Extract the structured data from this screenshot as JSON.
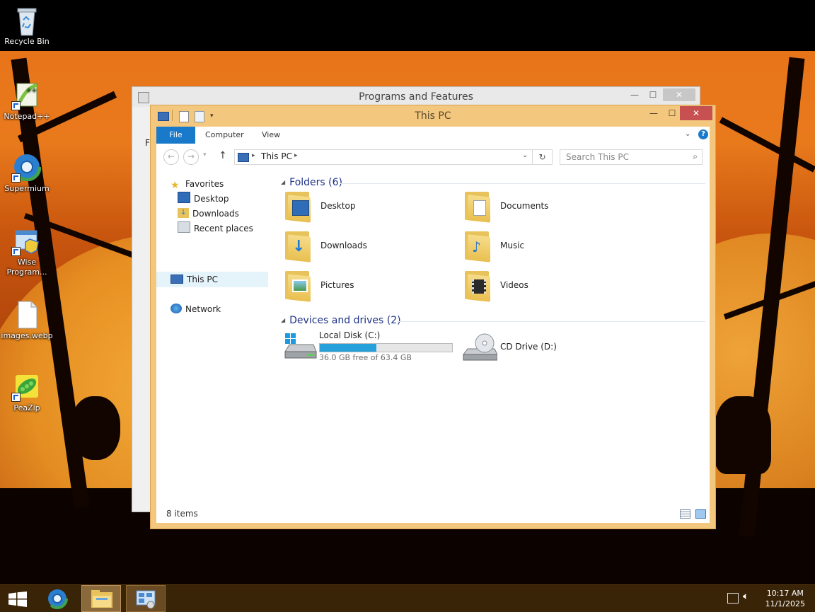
{
  "desktop": {
    "icons": [
      {
        "label": "Recycle Bin"
      },
      {
        "label": "Notepad++"
      },
      {
        "label": "Supermium"
      },
      {
        "label": "Wise Program..."
      },
      {
        "label": "images.webp"
      },
      {
        "label": "PeaZip"
      }
    ]
  },
  "background_window": {
    "title": "Programs and Features",
    "partial_label": "Fi"
  },
  "explorer": {
    "title": "This PC",
    "window_controls": {
      "minimize": "—",
      "maximize": "☐",
      "close": "✕"
    },
    "ribbon": {
      "tabs": [
        "File",
        "Computer",
        "View"
      ]
    },
    "address": {
      "path": "This PC",
      "search_placeholder": "Search This PC"
    },
    "nav_pane": {
      "favorites": "Favorites",
      "favorites_items": [
        "Desktop",
        "Downloads",
        "Recent places"
      ],
      "this_pc": "This PC",
      "network": "Network"
    },
    "folders_group": "Folders (6)",
    "folders": [
      "Desktop",
      "Documents",
      "Downloads",
      "Music",
      "Pictures",
      "Videos"
    ],
    "drives_group": "Devices and drives (2)",
    "drives": [
      {
        "name": "Local Disk (C:)",
        "free_text": "36.0 GB free of 63.4 GB",
        "used_fraction": 0.43
      },
      {
        "name": "CD Drive (D:)"
      }
    ],
    "status": "8 items"
  },
  "taskbar": {
    "time": "10:17 AM",
    "date": "11/1/2025"
  },
  "colors": {
    "window_frame": "#f3c77e",
    "accent": "#1979ca",
    "close_button": "#c75050",
    "group_header": "#1e3287",
    "drive_bar": "#26a0da",
    "taskbar": "#3a2408"
  }
}
